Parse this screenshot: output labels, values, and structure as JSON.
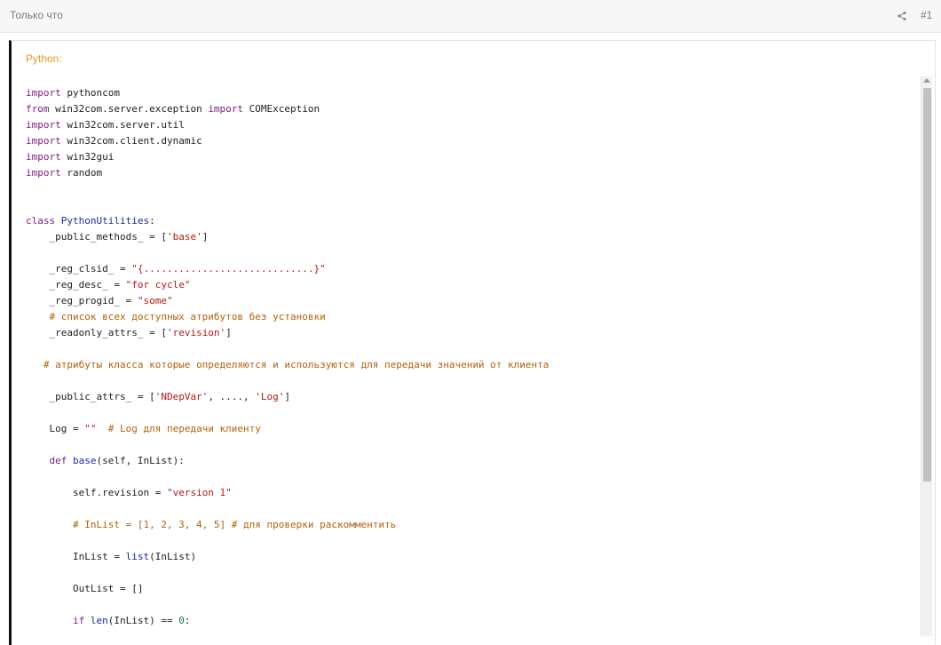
{
  "post": {
    "time": "Только что",
    "number": "#1",
    "share_icon": "share-icon"
  },
  "code_block": {
    "language_label": "Python:",
    "scroll_position": 0.0,
    "lines": [
      [
        {
          "t": "import",
          "c": "kw"
        },
        {
          "t": " pythoncom",
          "c": ""
        }
      ],
      [
        {
          "t": "from",
          "c": "kw"
        },
        {
          "t": " win32com.server.exception ",
          "c": ""
        },
        {
          "t": "import",
          "c": "kw"
        },
        {
          "t": " COMException",
          "c": ""
        }
      ],
      [
        {
          "t": "import",
          "c": "kw"
        },
        {
          "t": " win32com.server.util",
          "c": ""
        }
      ],
      [
        {
          "t": "import",
          "c": "kw"
        },
        {
          "t": " win32com.client.dynamic",
          "c": ""
        }
      ],
      [
        {
          "t": "import",
          "c": "kw"
        },
        {
          "t": " win32gui",
          "c": ""
        }
      ],
      [
        {
          "t": "import",
          "c": "kw"
        },
        {
          "t": " random",
          "c": ""
        }
      ],
      [],
      [],
      [
        {
          "t": "class",
          "c": "kw"
        },
        {
          "t": " ",
          "c": ""
        },
        {
          "t": "PythonUtilities",
          "c": "def"
        },
        {
          "t": ":",
          "c": ""
        }
      ],
      [
        {
          "t": "    _public_methods_ = [",
          "c": ""
        },
        {
          "t": "'base'",
          "c": "str"
        },
        {
          "t": "]",
          "c": ""
        }
      ],
      [],
      [
        {
          "t": "    _reg_clsid_ = ",
          "c": ""
        },
        {
          "t": "\"{.............................}\"",
          "c": "str"
        }
      ],
      [
        {
          "t": "    _reg_desc_ = ",
          "c": ""
        },
        {
          "t": "\"for cycle\"",
          "c": "str"
        }
      ],
      [
        {
          "t": "    _reg_progid_ = ",
          "c": ""
        },
        {
          "t": "\"some\"",
          "c": "str"
        }
      ],
      [
        {
          "t": "    # список всех доступных атрибутов без установки",
          "c": "cmt"
        }
      ],
      [
        {
          "t": "    _readonly_attrs_ = [",
          "c": ""
        },
        {
          "t": "'revision'",
          "c": "str"
        },
        {
          "t": "]",
          "c": ""
        }
      ],
      [],
      [
        {
          "t": "   # атрибуты класса которые определяются и используются для передачи значений от клиента",
          "c": "cmt"
        }
      ],
      [],
      [
        {
          "t": "    _public_attrs_ = [",
          "c": ""
        },
        {
          "t": "'NDepVar'",
          "c": "str"
        },
        {
          "t": ", ...., ",
          "c": ""
        },
        {
          "t": "'Log'",
          "c": "str"
        },
        {
          "t": "]",
          "c": ""
        }
      ],
      [],
      [
        {
          "t": "    Log = ",
          "c": ""
        },
        {
          "t": "\"\"",
          "c": "str"
        },
        {
          "t": "  # Log для передачи клиенту",
          "c": "cmt"
        }
      ],
      [],
      [
        {
          "t": "    ",
          "c": ""
        },
        {
          "t": "def",
          "c": "kw"
        },
        {
          "t": " ",
          "c": ""
        },
        {
          "t": "base",
          "c": "def"
        },
        {
          "t": "(self, InList):",
          "c": ""
        }
      ],
      [],
      [
        {
          "t": "        self.revision = ",
          "c": ""
        },
        {
          "t": "\"version 1\"",
          "c": "str"
        }
      ],
      [],
      [
        {
          "t": "        # InList = [1, 2, 3, 4, 5] # для проверки раскомментить",
          "c": "cmt"
        }
      ],
      [],
      [
        {
          "t": "        InList = ",
          "c": ""
        },
        {
          "t": "list",
          "c": "def"
        },
        {
          "t": "(InList)",
          "c": ""
        }
      ],
      [],
      [
        {
          "t": "        OutList = []",
          "c": ""
        }
      ],
      [],
      [
        {
          "t": "        ",
          "c": ""
        },
        {
          "t": "if",
          "c": "kw"
        },
        {
          "t": " ",
          "c": ""
        },
        {
          "t": "len",
          "c": "def"
        },
        {
          "t": "(InList) == ",
          "c": ""
        },
        {
          "t": "0",
          "c": "num"
        },
        {
          "t": ":",
          "c": ""
        }
      ]
    ]
  }
}
